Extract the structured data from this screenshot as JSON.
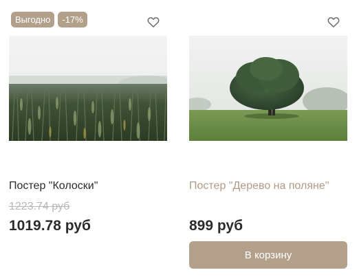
{
  "products": [
    {
      "badges": [
        "Выгодно",
        "-17%"
      ],
      "title": "Постер \"Колоски\"",
      "old_price": "1223.74 руб",
      "price": "1019.78 руб",
      "favorite_icon": "heart-outline-icon"
    },
    {
      "title": "Постер \"Дерево на поляне\"",
      "price": "899 руб",
      "cart_button": "В корзину",
      "favorite_icon": "heart-outline-icon"
    }
  ],
  "colors": {
    "accent": "#b3a08a",
    "title_hover": "#b09a86",
    "text": "#2b2b2b",
    "old_price": "#b6b6b6"
  }
}
